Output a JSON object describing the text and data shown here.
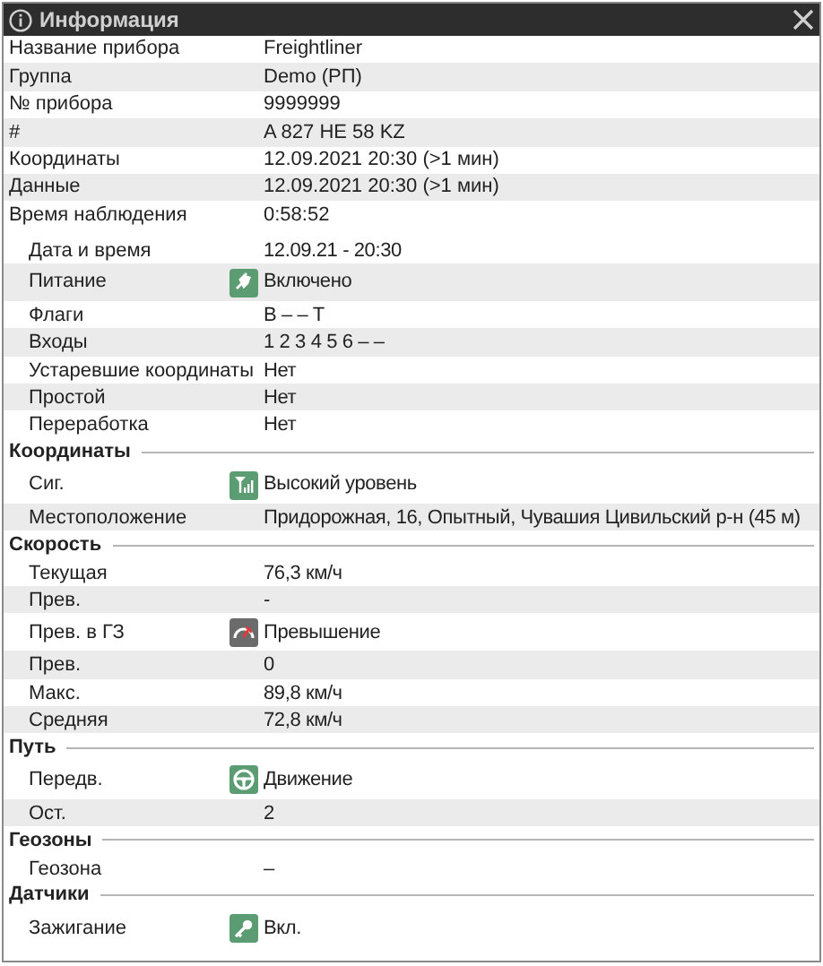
{
  "window": {
    "title": "Информация"
  },
  "fields": [
    {
      "label": "Название прибора",
      "value": "Freightliner"
    },
    {
      "label": "Группа",
      "value": "Demo (РП)"
    },
    {
      "label": "№ прибора",
      "value": "9999999"
    },
    {
      "label": "#",
      "value": "A 827 HE 58 KZ"
    },
    {
      "label": "Координаты",
      "value": "12.09.2021 20:30 (>1 мин)"
    },
    {
      "label": "Данные",
      "value": "12.09.2021 20:30 (>1 мин)"
    },
    {
      "label": "Время наблюдения",
      "value": "0:58:52"
    }
  ],
  "sections": [
    {
      "rows": [
        {
          "label": "Дата и время",
          "value": "12.09.21 - 20:30"
        },
        {
          "label": "Питание",
          "value": "Включено",
          "kind": "plug",
          "color": "#5b9c72"
        },
        {
          "label": "Флаги",
          "value": "B – – T"
        },
        {
          "label": "Входы",
          "value": "1 2 3 4 5 6 – –"
        },
        {
          "label": "Устаревшие координаты",
          "value": "Нет"
        },
        {
          "label": "Простой",
          "value": "Нет"
        },
        {
          "label": "Переработка",
          "value": "Нет"
        }
      ]
    },
    {
      "title": "Координаты",
      "rows": [
        {
          "label": "Сиг.",
          "value": "Высокий уровень",
          "kind": "antenna",
          "color": "#5b9c72"
        },
        {
          "label": "Местоположение",
          "value": "Придорожная, 16, Опытный, Чувашия Цивильский р-н (45 м)"
        }
      ]
    },
    {
      "title": "Скорость",
      "rows": [
        {
          "label": "Текущая",
          "value": "76,3 км/ч"
        },
        {
          "label": "Прев.",
          "value": "-"
        },
        {
          "label": "Прев. в ГЗ",
          "value": "Превышение",
          "kind": "gauge",
          "color": "#6b6b6b"
        },
        {
          "label": "Прев.",
          "value": "0"
        },
        {
          "label": "Макс.",
          "value": "89,8 км/ч"
        },
        {
          "label": "Средняя",
          "value": "72,8 км/ч"
        }
      ]
    },
    {
      "title": "Путь",
      "rows": [
        {
          "label": "Передв.",
          "value": "Движение",
          "kind": "wheel",
          "color": "#5b9c72"
        },
        {
          "label": "Ост.",
          "value": "2"
        }
      ]
    },
    {
      "title": "Геозоны",
      "rows": [
        {
          "label": "Геозона",
          "value": "–"
        }
      ]
    },
    {
      "title": "Датчики",
      "rows": [
        {
          "label": "Зажигание",
          "value": "Вкл.",
          "kind": "key",
          "color": "#5b9c72"
        }
      ]
    }
  ]
}
